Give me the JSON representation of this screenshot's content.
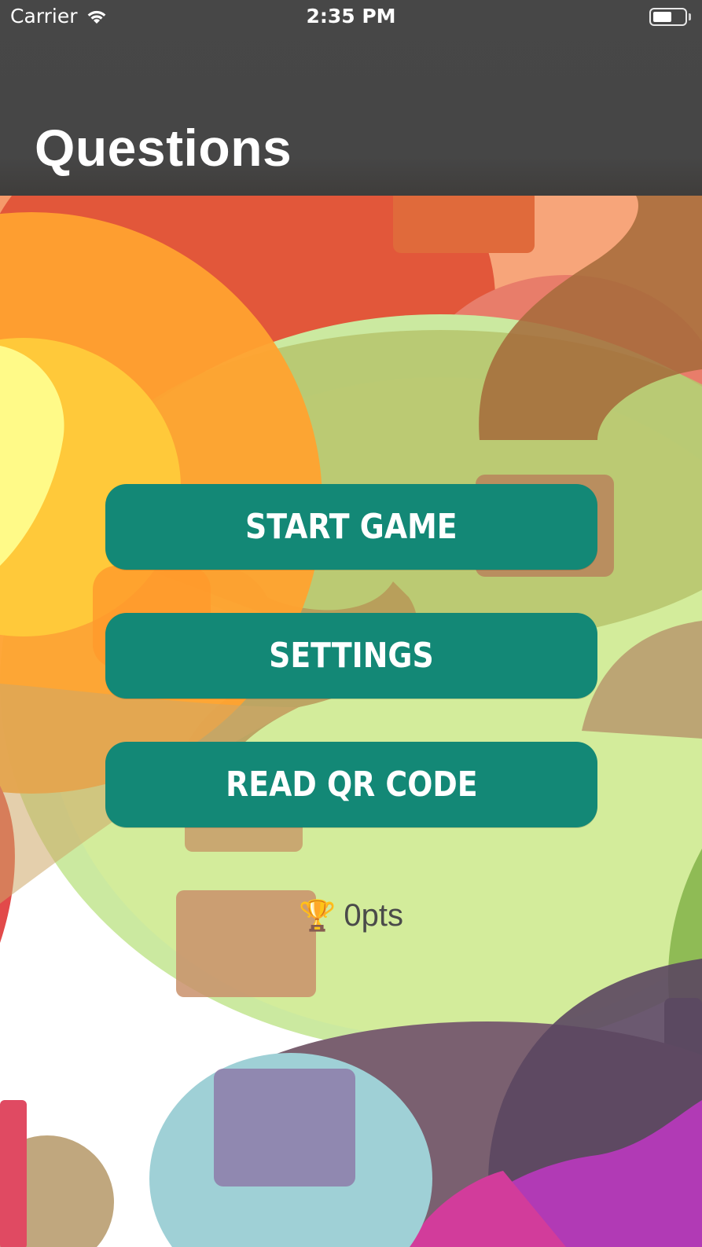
{
  "status_bar": {
    "carrier": "Carrier",
    "time": "2:35 PM",
    "battery_level": 0.6
  },
  "nav": {
    "title": "Questions"
  },
  "menu": {
    "start_label": "START GAME",
    "settings_label": "SETTINGS",
    "qr_label": "READ QR CODE"
  },
  "score": {
    "icon": "🏆",
    "text": "0pts"
  },
  "colors": {
    "button": "#138876",
    "navbar": "#464646"
  }
}
